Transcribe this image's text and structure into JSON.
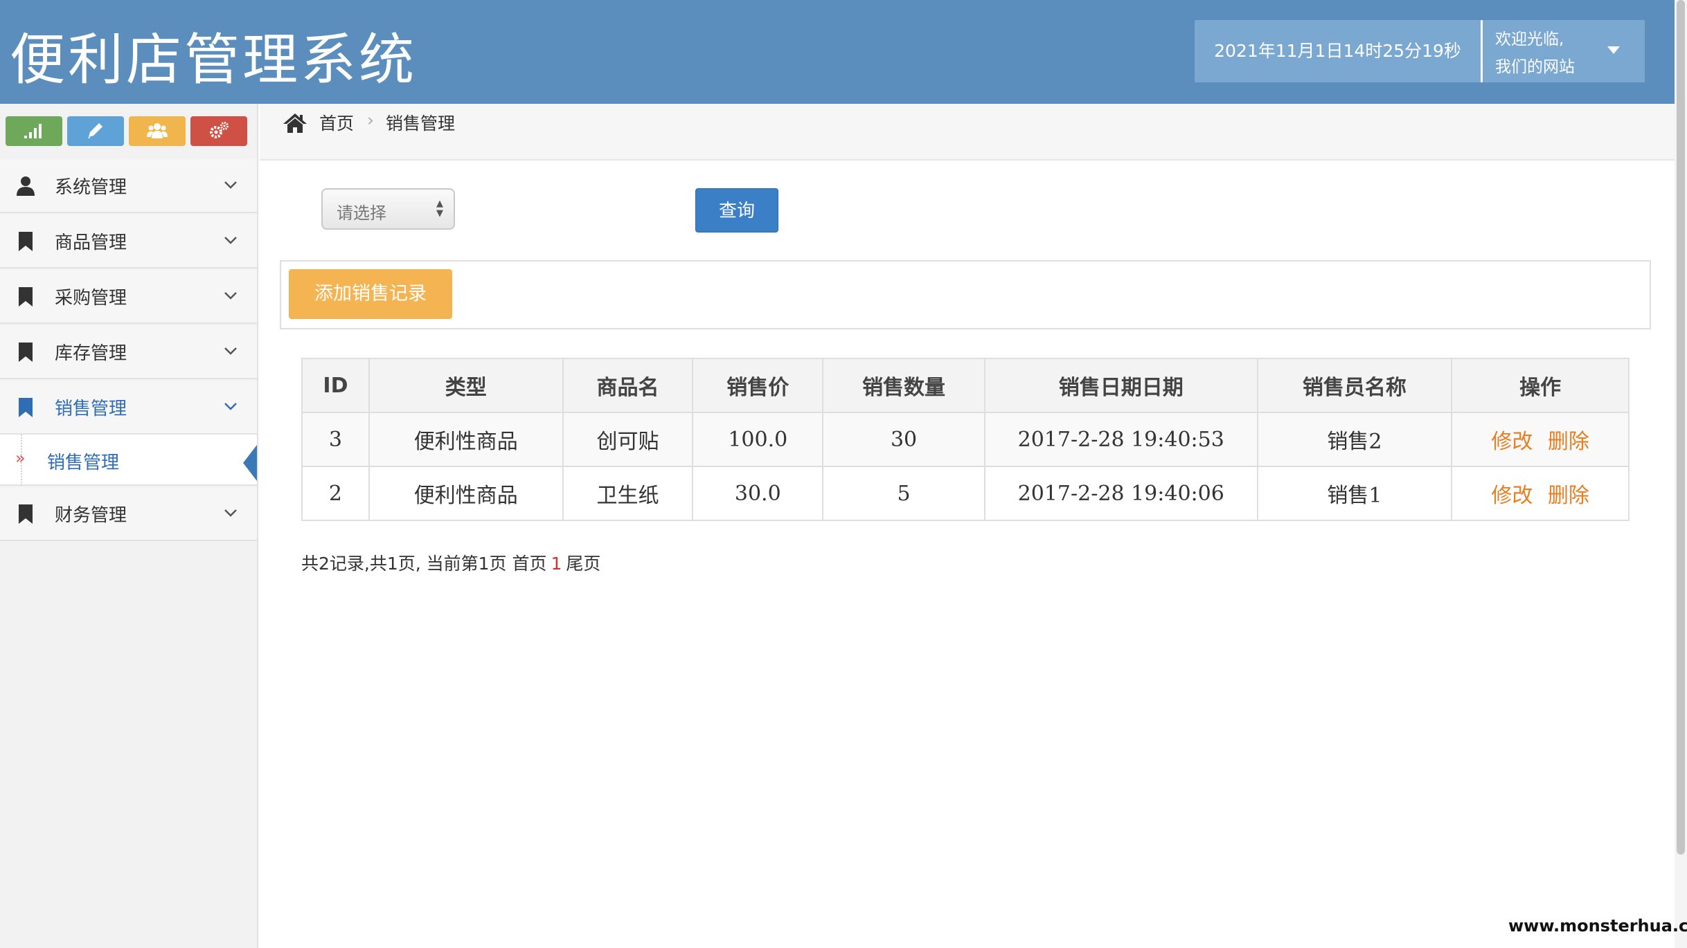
{
  "app": {
    "title": "便利店管理系统"
  },
  "header": {
    "datetime": "2021年11月1日14时25分19秒",
    "welcome_line1": "欢迎光临,",
    "welcome_line2": "我们的网站"
  },
  "shortcuts": [
    {
      "icon": "signal-icon",
      "color": "#6ea85a"
    },
    {
      "icon": "pencil-icon",
      "color": "#5fa2d7"
    },
    {
      "icon": "users-icon",
      "color": "#f0b54d"
    },
    {
      "icon": "cogs-icon",
      "color": "#cf5145"
    }
  ],
  "sidebar": {
    "items": [
      {
        "label": "系统管理",
        "icon": "user-icon"
      },
      {
        "label": "商品管理",
        "icon": "bookmark-icon"
      },
      {
        "label": "采购管理",
        "icon": "bookmark-icon"
      },
      {
        "label": "库存管理",
        "icon": "bookmark-icon"
      },
      {
        "label": "销售管理",
        "icon": "bookmark-icon",
        "active": true
      },
      {
        "label": "财务管理",
        "icon": "bookmark-icon"
      }
    ],
    "submenu": {
      "arrow": "»",
      "label": "销售管理"
    }
  },
  "breadcrumb": {
    "home": "首页",
    "separator": "›",
    "current": "销售管理"
  },
  "filter": {
    "select_value": "请选择",
    "query_label": "查询"
  },
  "actions": {
    "add_label": "添加销售记录"
  },
  "table": {
    "headers": [
      "ID",
      "类型",
      "商品名",
      "销售价",
      "销售数量",
      "销售日期日期",
      "销售员名称",
      "操作"
    ],
    "rows": [
      {
        "id": "3",
        "type": "便利性商品",
        "name": "创可贴",
        "price": "100.0",
        "qty": "30",
        "date": "2017-2-28 19:40:53",
        "seller": "销售2",
        "edit": "修改",
        "delete": "删除"
      },
      {
        "id": "2",
        "type": "便利性商品",
        "name": "卫生纸",
        "price": "30.0",
        "qty": "5",
        "date": "2017-2-28 19:40:06",
        "seller": "销售1",
        "edit": "修改",
        "delete": "删除"
      }
    ]
  },
  "pagination": {
    "summary": "共2记录,共1页, 当前第1页 首页",
    "current": "1",
    "last": "尾页"
  },
  "watermark": "www.monsterhua.com",
  "colors": {
    "header": "#5b8ebc",
    "primary": "#3b7fc7",
    "warning": "#f5b452",
    "link": "#e67e22",
    "active": "#2f6db5"
  }
}
